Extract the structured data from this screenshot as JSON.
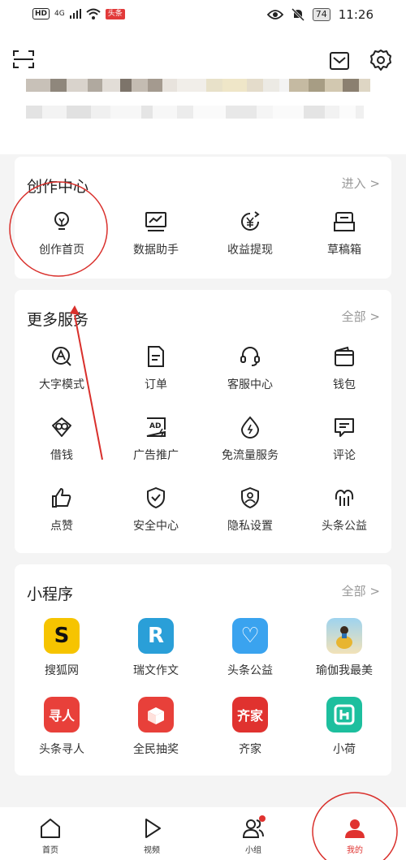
{
  "status_bar": {
    "network": "4G",
    "hd_label": "HD",
    "tag": "头条",
    "battery": "74",
    "time": "11:26"
  },
  "top": {
    "icons": [
      "scan-icon",
      "mail-icon",
      "gear-icon"
    ]
  },
  "creator_center": {
    "title": "创作中心",
    "more": "进入 >",
    "items": [
      {
        "label": "创作首页",
        "icon": "bulb-icon"
      },
      {
        "label": "数据助手",
        "icon": "chart-icon"
      },
      {
        "label": "收益提现",
        "icon": "yuan-icon"
      },
      {
        "label": "草稿箱",
        "icon": "draft-icon"
      }
    ]
  },
  "more_services": {
    "title": "更多服务",
    "more": "全部 >",
    "items": [
      {
        "label": "大字模式",
        "icon": "large-font-icon"
      },
      {
        "label": "订单",
        "icon": "order-icon"
      },
      {
        "label": "客服中心",
        "icon": "headset-icon"
      },
      {
        "label": "钱包",
        "icon": "wallet-icon"
      },
      {
        "label": "借钱",
        "icon": "loan-icon"
      },
      {
        "label": "广告推广",
        "icon": "ad-icon"
      },
      {
        "label": "免流量服务",
        "icon": "data-drop-icon"
      },
      {
        "label": "评论",
        "icon": "comment-icon"
      },
      {
        "label": "点赞",
        "icon": "thumbs-up-icon"
      },
      {
        "label": "安全中心",
        "icon": "shield-icon"
      },
      {
        "label": "隐私设置",
        "icon": "privacy-icon"
      },
      {
        "label": "头条公益",
        "icon": "charity-icon"
      }
    ]
  },
  "mini_programs": {
    "title": "小程序",
    "more": "全部 >",
    "items": [
      {
        "label": "搜狐网",
        "glyph": "S",
        "color": "#f6c400"
      },
      {
        "label": "瑞文作文",
        "glyph": "R",
        "color": "#2a9fd8"
      },
      {
        "label": "头条公益",
        "glyph": "♡",
        "color": "#3aa3ef"
      },
      {
        "label": "瑜伽我最美",
        "glyph": "",
        "color": "#8fc9e8"
      },
      {
        "label": "头条寻人",
        "glyph": "寻人",
        "color": "#e8403a"
      },
      {
        "label": "全民抽奖",
        "glyph": "",
        "color": "#e8403a"
      },
      {
        "label": "齐家",
        "glyph": "齐家",
        "color": "#e0322f"
      },
      {
        "label": "小荷",
        "glyph": "",
        "color": "#1dbf9e"
      }
    ]
  },
  "tabbar": {
    "items": [
      {
        "label": "首页"
      },
      {
        "label": "视频"
      },
      {
        "label": "小组"
      },
      {
        "label": "我的"
      }
    ]
  },
  "colors": {
    "accent": "#e0322f",
    "annotation": "#d9302c",
    "muted": "#999999"
  }
}
